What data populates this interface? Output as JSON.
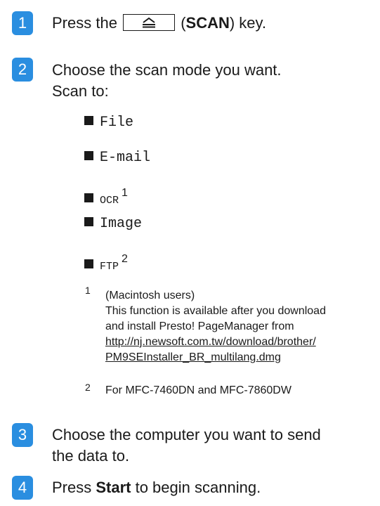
{
  "steps": [
    {
      "number": "1",
      "text_before": "Press the",
      "text_paren_open": "(",
      "key_name": "SCAN",
      "text_paren_close": ")",
      "text_after": " key."
    },
    {
      "number": "2",
      "line1": "Choose the scan mode you want.",
      "line2": "Scan to:"
    },
    {
      "number": "3",
      "line1": "Choose the computer you want to send",
      "line2": "the data to."
    },
    {
      "number": "4",
      "text_before": "Press ",
      "bold": "Start",
      "text_after": " to begin scanning."
    }
  ],
  "scan_modes": [
    {
      "label": "File",
      "note": ""
    },
    {
      "label": "E-mail",
      "note": ""
    },
    {
      "label": "OCR",
      "note": "1"
    },
    {
      "label": "Image",
      "note": ""
    },
    {
      "label": "FTP",
      "note": "2"
    }
  ],
  "footnotes": [
    {
      "number": "1",
      "line1": "(Macintosh users)",
      "line2": "This function is available after you download",
      "line3": "and install Presto! PageManager from",
      "link1": "http://nj.newsoft.com.tw/download/brother/",
      "link2": "PM9SEInstaller_BR_multilang.dmg"
    },
    {
      "number": "2",
      "text": "For MFC-7460DN and MFC-7860DW"
    }
  ],
  "icons": {
    "scan_key": "scan-key-icon",
    "bullet": "square-bullet-icon"
  },
  "colors": {
    "badge": "#2a8ee0",
    "text": "#1a1a1a"
  }
}
